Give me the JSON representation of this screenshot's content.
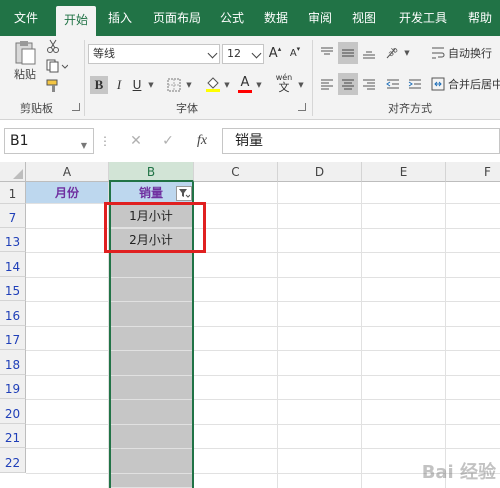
{
  "tabs": [
    "文件",
    "开始",
    "插入",
    "页面布局",
    "公式",
    "数据",
    "审阅",
    "视图",
    "开发工具",
    "帮助"
  ],
  "ribbon": {
    "clipboard": {
      "paste_label": "粘贴",
      "group_label": "剪贴板"
    },
    "font": {
      "name": "等线",
      "size": "12",
      "bold": "B",
      "italic": "I",
      "underline": "U",
      "grow": "A",
      "shrink": "A",
      "color_a": "A",
      "phonetic": "wén",
      "group_label": "字体"
    },
    "alignment": {
      "wrap_text": "自动换行",
      "merge_center": "合并后居中",
      "group_label": "对齐方式"
    }
  },
  "formula_bar": {
    "name_box": "B1",
    "fx_label": "fx",
    "value": "销量"
  },
  "columns": [
    "A",
    "B",
    "C",
    "D",
    "E",
    "F"
  ],
  "rows": [
    "1",
    "7",
    "13",
    "14",
    "15",
    "16",
    "17",
    "18",
    "19",
    "20",
    "21",
    "22"
  ],
  "cells": {
    "A1": "月份",
    "B1": "销量",
    "B7": "1月小计",
    "B13": "2月小计"
  },
  "colors": {
    "accent": "#217346",
    "header_fill": "#bdd7ee",
    "header_text": "#7030a0",
    "highlight_box": "#e02020",
    "filtered_row_num": "#1f3fb8"
  },
  "watermark": "Bai 经验"
}
